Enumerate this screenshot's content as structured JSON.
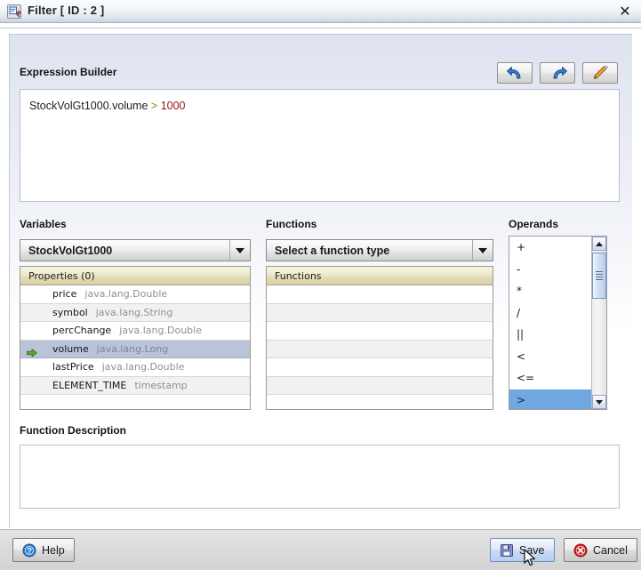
{
  "window": {
    "title": "Filter [ ID : 2 ]",
    "icon": "filter-icon",
    "close_label": "✕"
  },
  "expression_builder": {
    "label": "Expression Builder",
    "expression": "StockVolGt1000.volume > 1000",
    "expression_tokens": [
      {
        "text": "StockVolGt1000.volume ",
        "type": "identifier"
      },
      {
        "text": ">",
        "type": "operator"
      },
      {
        "text": " ",
        "type": "plain"
      },
      {
        "text": "1000",
        "type": "number"
      }
    ],
    "toolbar": [
      {
        "name": "undo-button",
        "tooltip": "Undo",
        "icon": "undo-icon"
      },
      {
        "name": "redo-button",
        "tooltip": "Redo",
        "icon": "redo-icon"
      },
      {
        "name": "clear-button",
        "tooltip": "Clear",
        "icon": "eraser-icon"
      }
    ]
  },
  "variables": {
    "label": "Variables",
    "selected": "StockVolGt1000",
    "dropdown_icon": "chevron-down-icon",
    "table_header": "Properties (0)",
    "rows": [
      {
        "name": "price",
        "type": "java.lang.Double",
        "selected": false
      },
      {
        "name": "symbol",
        "type": "java.lang.String",
        "selected": false
      },
      {
        "name": "percChange",
        "type": "java.lang.Double",
        "selected": false
      },
      {
        "name": "volume",
        "type": "java.lang.Long",
        "selected": true
      },
      {
        "name": "lastPrice",
        "type": "java.lang.Double",
        "selected": false
      },
      {
        "name": "ELEMENT_TIME",
        "type": "timestamp",
        "selected": false
      },
      {
        "name": "",
        "type": "",
        "selected": false
      }
    ]
  },
  "functions": {
    "label": "Functions",
    "selected": "Select a function type",
    "dropdown_icon": "chevron-down-icon",
    "table_header": "Functions",
    "rows": [
      "",
      "",
      "",
      "",
      "",
      "",
      ""
    ]
  },
  "operands": {
    "label": "Operands",
    "items": [
      {
        "symbol": "+",
        "selected": false
      },
      {
        "symbol": "-",
        "selected": false
      },
      {
        "symbol": "*",
        "selected": false
      },
      {
        "symbol": "/",
        "selected": false
      },
      {
        "symbol": "||",
        "selected": false
      },
      {
        "symbol": "<",
        "selected": false
      },
      {
        "symbol": "<=",
        "selected": false
      },
      {
        "symbol": ">",
        "selected": true
      }
    ],
    "scroll_up_icon": "triangle-up-icon",
    "scroll_down_icon": "triangle-down-icon"
  },
  "function_description": {
    "label": "Function Description",
    "text": ""
  },
  "footer": {
    "help_label": "Help",
    "help_icon": "question-circle-icon",
    "save_label": "Save",
    "save_icon": "floppy-disk-icon",
    "save_hovered": true,
    "cancel_label": "Cancel",
    "cancel_icon": "cancel-circle-icon"
  },
  "colors": {
    "titlebar_bg": "#eef1f7",
    "panel_top": "#dfe3ef",
    "selection_blue": "#6fa8e0",
    "row_selected": "#b9c3da",
    "table_header": "#e9e3c2",
    "operator_token": "#8a8a00",
    "number_token": "#9a1414",
    "accent_blue": "#2f6fbd"
  }
}
